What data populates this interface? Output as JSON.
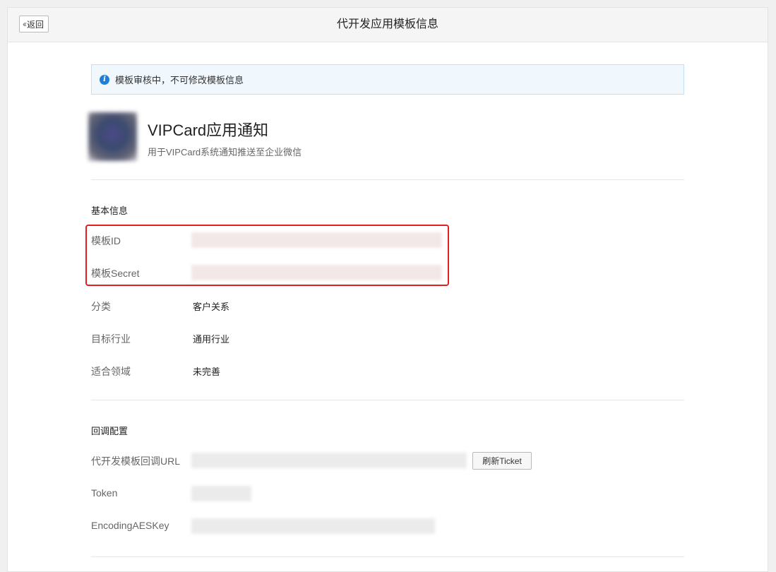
{
  "header": {
    "back_label": "返回",
    "title": "代开发应用模板信息"
  },
  "notice": {
    "icon": "info-icon",
    "text": "模板审核中，不可修改模板信息"
  },
  "app": {
    "name": "VIPCard应用通知",
    "description": "用于VIPCard系统通知推送至企业微信"
  },
  "basic_info": {
    "section_title": "基本信息",
    "template_id_label": "模板ID",
    "template_secret_label": "模板Secret",
    "category_label": "分类",
    "category_value": "客户关系",
    "industry_label": "目标行业",
    "industry_value": "通用行业",
    "domain_label": "适合领域",
    "domain_value": "未完善"
  },
  "callback": {
    "section_title": "回调配置",
    "url_label": "代开发模板回调URL",
    "refresh_button": "刷新Ticket",
    "token_label": "Token",
    "aeskey_label": "EncodingAESKey"
  },
  "colors": {
    "highlight": "#e21f1f",
    "info_blue": "#1e7fd9"
  }
}
